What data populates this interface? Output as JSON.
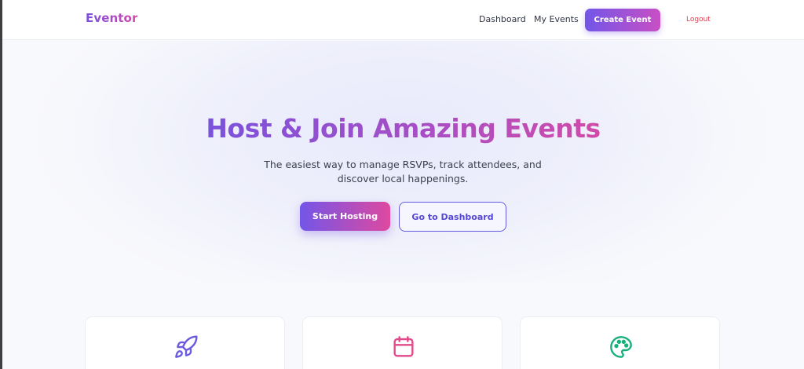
{
  "nav": {
    "brand": "Eventor",
    "links": [
      {
        "label": "Dashboard"
      },
      {
        "label": "My Events"
      }
    ],
    "create_button": "Create Event",
    "logout": "Logout"
  },
  "hero": {
    "title": "Host & Join Amazing Events",
    "subtitle": "The easiest way to manage RSVPs, track attendees, and discover local happenings.",
    "primary_button": "Start Hosting",
    "secondary_button": "Go to Dashboard"
  },
  "features": [
    {
      "icon": "rocket-icon",
      "color": "#6a5ae0"
    },
    {
      "icon": "calendar-icon",
      "color": "#e24a8a"
    },
    {
      "icon": "palette-icon",
      "color": "#18b07a"
    }
  ],
  "colors": {
    "brand_start": "#7b4fe0",
    "brand_end": "#d14aa8",
    "logout": "#e23b4e"
  }
}
